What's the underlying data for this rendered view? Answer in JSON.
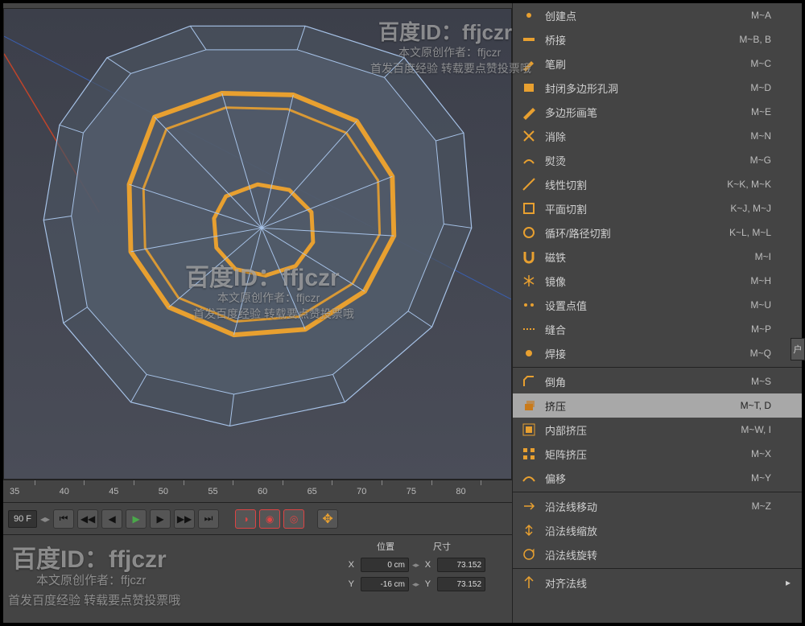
{
  "watermark": {
    "main": "百度ID：ffjczr",
    "line1": "本文原创作者：ffjczr",
    "line2": "首发百度经验 转载要点赞投票哦"
  },
  "timeline": {
    "ticks": [
      "35",
      "40",
      "45",
      "50",
      "55",
      "60",
      "65",
      "70",
      "75",
      "80"
    ]
  },
  "playback": {
    "frame_end": "90 F"
  },
  "coords": {
    "pos_label": "位置",
    "size_label": "尺寸",
    "x": {
      "pos": "0 cm",
      "size": "73.152"
    },
    "y": {
      "pos": "-16 cm",
      "size": "73.152"
    }
  },
  "menu": {
    "side_tab": "户",
    "groups": [
      [
        {
          "icon": "dot",
          "label": "创建点",
          "shortcut": "M~A",
          "sub": false
        },
        {
          "icon": "bridge",
          "label": "桥接",
          "shortcut": "M~B, B",
          "sub": false
        },
        {
          "icon": "brush",
          "label": "笔刷",
          "shortcut": "M~C",
          "sub": false
        },
        {
          "icon": "fill",
          "label": "封闭多边形孔洞",
          "shortcut": "M~D",
          "sub": false
        },
        {
          "icon": "pen",
          "label": "多边形画笔",
          "shortcut": "M~E",
          "sub": false
        },
        {
          "icon": "del",
          "label": "消除",
          "shortcut": "M~N",
          "sub": false
        },
        {
          "icon": "iron",
          "label": "熨烫",
          "shortcut": "M~G",
          "sub": false
        },
        {
          "icon": "knife",
          "label": "线性切割",
          "shortcut": "K~K, M~K",
          "sub": false
        },
        {
          "icon": "plane",
          "label": "平面切割",
          "shortcut": "K~J, M~J",
          "sub": false
        },
        {
          "icon": "loop",
          "label": "循环/路径切割",
          "shortcut": "K~L, M~L",
          "sub": false
        },
        {
          "icon": "magnet",
          "label": "磁铁",
          "shortcut": "M~I",
          "sub": false
        },
        {
          "icon": "mirror",
          "label": "镜像",
          "shortcut": "M~H",
          "sub": false
        },
        {
          "icon": "setpt",
          "label": "设置点值",
          "shortcut": "M~U",
          "sub": false
        },
        {
          "icon": "stitch",
          "label": "缝合",
          "shortcut": "M~P",
          "sub": false
        },
        {
          "icon": "weld",
          "label": "焊接",
          "shortcut": "M~Q",
          "sub": false
        }
      ],
      [
        {
          "icon": "bevel",
          "label": "倒角",
          "shortcut": "M~S",
          "sub": false
        },
        {
          "icon": "extrude",
          "label": "挤压",
          "shortcut": "M~T, D",
          "sub": false,
          "selected": true
        },
        {
          "icon": "inset",
          "label": "内部挤压",
          "shortcut": "M~W, I",
          "sub": false
        },
        {
          "icon": "matrix",
          "label": "矩阵挤压",
          "shortcut": "M~X",
          "sub": false
        },
        {
          "icon": "smooth",
          "label": "偏移",
          "shortcut": "M~Y",
          "sub": false
        }
      ],
      [
        {
          "icon": "slide",
          "label": "沿法线移动",
          "shortcut": "M~Z",
          "sub": false
        },
        {
          "icon": "slide2",
          "label": "沿法线缩放",
          "shortcut": "",
          "sub": false
        },
        {
          "icon": "slide3",
          "label": "沿法线旋转",
          "shortcut": "",
          "sub": false
        }
      ],
      [
        {
          "icon": "normal",
          "label": "对齐法线",
          "shortcut": "",
          "sub": true
        }
      ]
    ]
  }
}
